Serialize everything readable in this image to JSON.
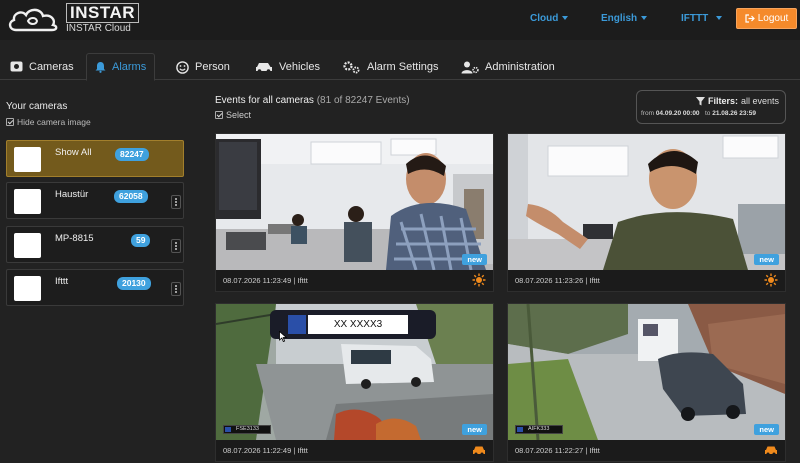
{
  "header": {
    "brand_title": "INSTAR",
    "brand_sub": "INSTAR Cloud",
    "nav": [
      {
        "label": "Cloud"
      },
      {
        "label": "English"
      },
      {
        "label": "IFTTT"
      }
    ],
    "logout_label": "Logout"
  },
  "tabs": [
    {
      "label": "Cameras",
      "icon": "camera-icon",
      "active": false
    },
    {
      "label": "Alarms",
      "icon": "bell-icon",
      "active": true
    },
    {
      "label": "Person",
      "icon": "smiley-icon",
      "active": false
    },
    {
      "label": "Vehicles",
      "icon": "car-icon",
      "active": false
    },
    {
      "label": "Alarm Settings",
      "icon": "gears-icon",
      "active": false
    },
    {
      "label": "Administration",
      "icon": "user-gear-icon",
      "active": false
    }
  ],
  "sidebar": {
    "title": "Your cameras",
    "hide_image_label": "Hide camera image",
    "cameras": [
      {
        "name": "Show All",
        "count": "82247",
        "selected": true
      },
      {
        "name": "Haustür",
        "count": "62058",
        "selected": false
      },
      {
        "name": "MP-8815",
        "count": "59",
        "selected": false
      },
      {
        "name": "Ifttt",
        "count": "20130",
        "selected": false
      }
    ]
  },
  "events": {
    "title": "Events for all cameras",
    "count_text": "(81 of 82247 Events)",
    "select_label": "Select",
    "filters": {
      "label": "Filters:",
      "value": "all events",
      "from_label": "from",
      "from_value": "04.09.20 00:00",
      "to_label": "to",
      "to_value": "21.08.26 23:59"
    },
    "cards": [
      {
        "timestamp": "08.07.2026 11:23:49 | Ifttt",
        "badge": "new",
        "type_icon": "motion-alarm-icon"
      },
      {
        "timestamp": "08.07.2026 11:23:26 | Ifttt",
        "badge": "new",
        "type_icon": "motion-alarm-icon"
      },
      {
        "timestamp": "08.07.2026 11:22:49 | Ifttt",
        "badge": "new",
        "type_icon": "car-icon",
        "plate": "XX XXXX3",
        "mini_plate": "FSE3133"
      },
      {
        "timestamp": "08.07.2026 11:22:27 | Ifttt",
        "badge": "new",
        "type_icon": "car-icon",
        "mini_plate": "AIFK333"
      }
    ]
  },
  "colors": {
    "accent": "#3b9ad9",
    "logout": "#f58a2b",
    "selected_camera": "#735a1c",
    "badge": "#3fa1de",
    "alarm_icon": "#f08a1c"
  }
}
